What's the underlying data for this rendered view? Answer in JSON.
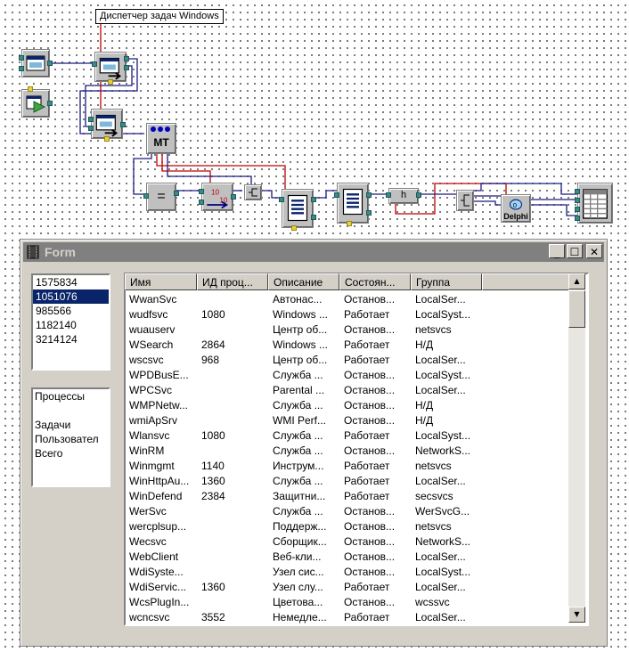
{
  "scheme": {
    "caption_label": "Диспетчер задач Windows",
    "component_icons": [
      "form-icon",
      "run-icon",
      "form-show-icon",
      "form-show-icon",
      "multi-thread-icon",
      "equal-icon",
      "stepper-icon",
      "split-icon",
      "list-icon",
      "list-icon",
      "hub-icon",
      "split-icon",
      "delphi-icon",
      "listview-icon"
    ],
    "mt_label": "MT",
    "eq_label": "=",
    "h_label": "h",
    "delphi_label": "Delphi"
  },
  "form": {
    "title": "Form",
    "buttons": {
      "minimize": "_",
      "maximize": "☐",
      "close": "✕"
    },
    "pid_list": {
      "items": [
        "1575834",
        "1051076",
        "985566",
        "1182140",
        "3214124"
      ],
      "selected_index": 1
    },
    "memo": {
      "lines": [
        "Процессы",
        "",
        "Задачи",
        "Пользовател",
        "Всего"
      ]
    },
    "listview": {
      "columns": [
        "Имя",
        "ИД проц...",
        "Описание",
        "Состоян...",
        "Группа",
        ""
      ],
      "rows": [
        [
          "WwanSvc",
          "",
          "Автонас...",
          "Останов...",
          "LocalSer..."
        ],
        [
          "wudfsvc",
          "1080",
          "Windows ...",
          "Работает",
          "LocalSyst..."
        ],
        [
          "wuauserv",
          "",
          "Центр об...",
          "Останов...",
          "netsvcs"
        ],
        [
          "WSearch",
          "2864",
          "Windows ...",
          "Работает",
          "Н/Д"
        ],
        [
          "wscsvc",
          "968",
          "Центр об...",
          "Работает",
          "LocalSer..."
        ],
        [
          "WPDBusE...",
          "",
          "Служба ...",
          "Останов...",
          "LocalSyst..."
        ],
        [
          "WPCSvc",
          "",
          "Parental ...",
          "Останов...",
          "LocalSer..."
        ],
        [
          "WMPNetw...",
          "",
          "Служба ...",
          "Останов...",
          "Н/Д"
        ],
        [
          "wmiApSrv",
          "",
          "WMI Perf...",
          "Останов...",
          "Н/Д"
        ],
        [
          "Wlansvc",
          "1080",
          "Служба ...",
          "Работает",
          "LocalSyst..."
        ],
        [
          "WinRM",
          "",
          "Служба ...",
          "Останов...",
          "NetworkS..."
        ],
        [
          "Winmgmt",
          "1140",
          "Инструм...",
          "Работает",
          "netsvcs"
        ],
        [
          "WinHttpAu...",
          "1360",
          "Служба ...",
          "Работает",
          "LocalSer..."
        ],
        [
          "WinDefend",
          "2384",
          "Защитни...",
          "Работает",
          "secsvcs"
        ],
        [
          "WerSvc",
          "",
          "Служба ...",
          "Останов...",
          "WerSvcG..."
        ],
        [
          "wercplsup...",
          "",
          "Поддерж...",
          "Останов...",
          "netsvcs"
        ],
        [
          "Wecsvc",
          "",
          "Сборщик...",
          "Останов...",
          "NetworkS..."
        ],
        [
          "WebClient",
          "",
          "Веб-кли...",
          "Останов...",
          "LocalSer..."
        ],
        [
          "WdiSyste...",
          "",
          "Узел сис...",
          "Останов...",
          "LocalSyst..."
        ],
        [
          "WdiServic...",
          "1360",
          "Узел слу...",
          "Работает",
          "LocalSer..."
        ],
        [
          "WcsPlugIn...",
          "",
          "Цветова...",
          "Останов...",
          "wcssvc"
        ],
        [
          "wcncsvc",
          "3552",
          "Немедле...",
          "Работает",
          "LocalSer..."
        ]
      ]
    },
    "scrollbar": {
      "up": "▲",
      "down": "▼"
    }
  }
}
